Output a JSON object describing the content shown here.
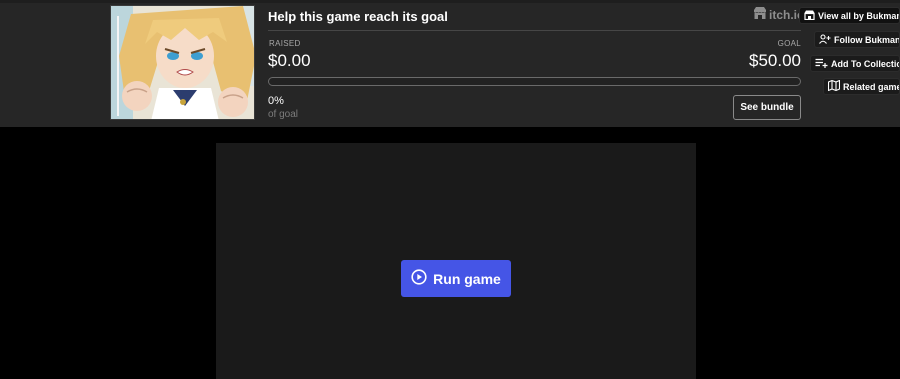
{
  "goal": {
    "title": "Help this game reach its goal",
    "raised_label": "RAISED",
    "raised_value": "$0.00",
    "goal_label": "GOAL",
    "goal_value": "$50.00",
    "progress_fraction": 0,
    "percent": "0%",
    "percent_caption": "of goal",
    "bundle_button": "See bundle"
  },
  "brand": {
    "logo_text": "itch.io",
    "icon": "itch-io-icon"
  },
  "sidebar": {
    "view_all": {
      "label": "View all by Bukmand",
      "icon": "storefront-icon"
    },
    "follow": {
      "label": "Follow Bukmand",
      "icon": "user-plus-icon"
    },
    "add_collection": {
      "label": "Add To Collection",
      "icon": "playlist-add-icon"
    },
    "related": {
      "label": "Related games",
      "icon": "map-icon"
    }
  },
  "game": {
    "run_label": "Run game",
    "icon": "play-circle-icon"
  },
  "colors": {
    "accent": "#4555e6",
    "banner_bg": "#262626",
    "frame_bg": "#1a1a1a",
    "progress_fill": "#fa5c5c"
  }
}
